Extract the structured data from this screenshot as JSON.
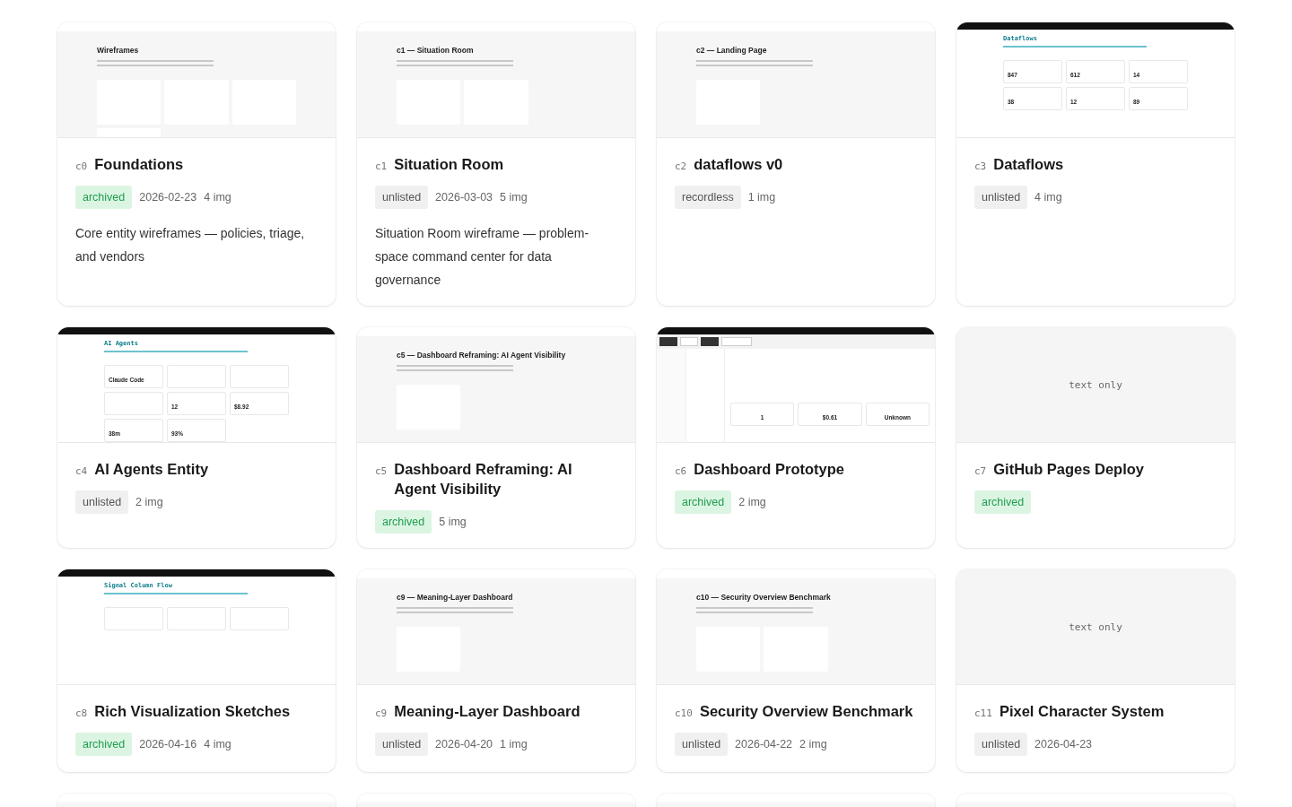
{
  "cards": [
    {
      "id": "c0",
      "title": "Foundations",
      "status": "archived",
      "date": "2026-02-23",
      "images": "4 img",
      "description": "Core entity wireframes — policies, triage, and vendors",
      "thumb": {
        "kind": "doc",
        "title": "Wireframes",
        "items": [
          {
            "kind": "card"
          },
          {
            "kind": "card"
          },
          {
            "kind": "card"
          },
          {
            "kind": "card"
          }
        ]
      }
    },
    {
      "id": "c1",
      "title": "Situation Room",
      "status": "unlisted",
      "date": "2026-03-03",
      "images": "5 img",
      "description": "Situation Room wireframe — problem-space command center for data governance",
      "thumb": {
        "kind": "doc",
        "title": "c1 — Situation Room",
        "items": [
          {
            "kind": "card"
          },
          {
            "kind": "card"
          }
        ]
      }
    },
    {
      "id": "c2",
      "title": "dataflows v0",
      "status": "recordless",
      "images": "1 img",
      "thumb": {
        "kind": "doc",
        "title": "c2 — Landing Page",
        "items": [
          {
            "kind": "card"
          }
        ]
      }
    },
    {
      "id": "c3",
      "title": "Dataflows",
      "status": "unlisted",
      "images": "4 img",
      "thumb": {
        "kind": "console",
        "title": "Dataflows",
        "items": [
          {
            "kind": "stat",
            "value": "847"
          },
          {
            "kind": "stat",
            "value": "612"
          },
          {
            "kind": "stat",
            "value": "14"
          },
          {
            "kind": "stat",
            "value": "38"
          },
          {
            "kind": "stat",
            "value": "12"
          },
          {
            "kind": "stat",
            "value": "89"
          }
        ]
      }
    },
    {
      "id": "c4",
      "title": "AI Agents Entity",
      "status": "unlisted",
      "images": "2 img",
      "thumb": {
        "kind": "console",
        "title": "AI Agents",
        "items": [
          {
            "kind": "stat",
            "value": "Claude Code"
          },
          {
            "kind": "blank"
          },
          {
            "kind": "blank"
          },
          {
            "kind": "blank"
          },
          {
            "kind": "stat",
            "value": "12"
          },
          {
            "kind": "stat",
            "value": "$8.92"
          },
          {
            "kind": "stat",
            "value": "38m"
          },
          {
            "kind": "stat",
            "value": "93%"
          }
        ]
      }
    },
    {
      "id": "c5",
      "title": "Dashboard Reframing: AI Agent Visibility",
      "status": "archived",
      "images": "5 img",
      "thumb": {
        "kind": "doc",
        "title": "c5 — Dashboard Reframing: AI Agent Visibility",
        "items": [
          {
            "kind": "card"
          }
        ]
      }
    },
    {
      "id": "c6",
      "title": "Dashboard Prototype",
      "status": "archived",
      "images": "2 img",
      "thumb": {
        "kind": "app",
        "items": [
          {
            "kind": "stat",
            "value": "1"
          },
          {
            "kind": "stat",
            "value": "$0.61"
          },
          {
            "kind": "stat",
            "value": "Unknown"
          }
        ]
      }
    },
    {
      "id": "c7",
      "title": "GitHub Pages Deploy",
      "status": "archived",
      "thumb": {
        "kind": "text",
        "label": "text only"
      }
    },
    {
      "id": "c8",
      "title": "Rich Visualization Sketches",
      "status": "archived",
      "date": "2026-04-16",
      "images": "4 img",
      "thumb": {
        "kind": "console",
        "title": "Signal Column Flow",
        "items": [
          {
            "kind": "blank"
          },
          {
            "kind": "blank"
          },
          {
            "kind": "blank"
          }
        ]
      }
    },
    {
      "id": "c9",
      "title": "Meaning-Layer Dashboard",
      "status": "unlisted",
      "date": "2026-04-20",
      "images": "1 img",
      "thumb": {
        "kind": "doc",
        "title": "c9 — Meaning-Layer Dashboard",
        "items": [
          {
            "kind": "card"
          }
        ]
      }
    },
    {
      "id": "c10",
      "title": "Security Overview Benchmark",
      "status": "unlisted",
      "date": "2026-04-22",
      "images": "2 img",
      "thumb": {
        "kind": "doc",
        "title": "c10 — Security Overview Benchmark",
        "items": [
          {
            "kind": "card"
          },
          {
            "kind": "card"
          }
        ]
      }
    },
    {
      "id": "c11",
      "title": "Pixel Character System",
      "status": "unlisted",
      "date": "2026-04-23",
      "thumb": {
        "kind": "text",
        "label": "text only"
      }
    },
    {
      "thumb": {
        "kind": "doc"
      }
    },
    {
      "thumb": {
        "kind": "doc"
      }
    },
    {
      "thumb": {
        "kind": "doc"
      }
    },
    {
      "thumb": {
        "kind": "doc"
      }
    }
  ]
}
